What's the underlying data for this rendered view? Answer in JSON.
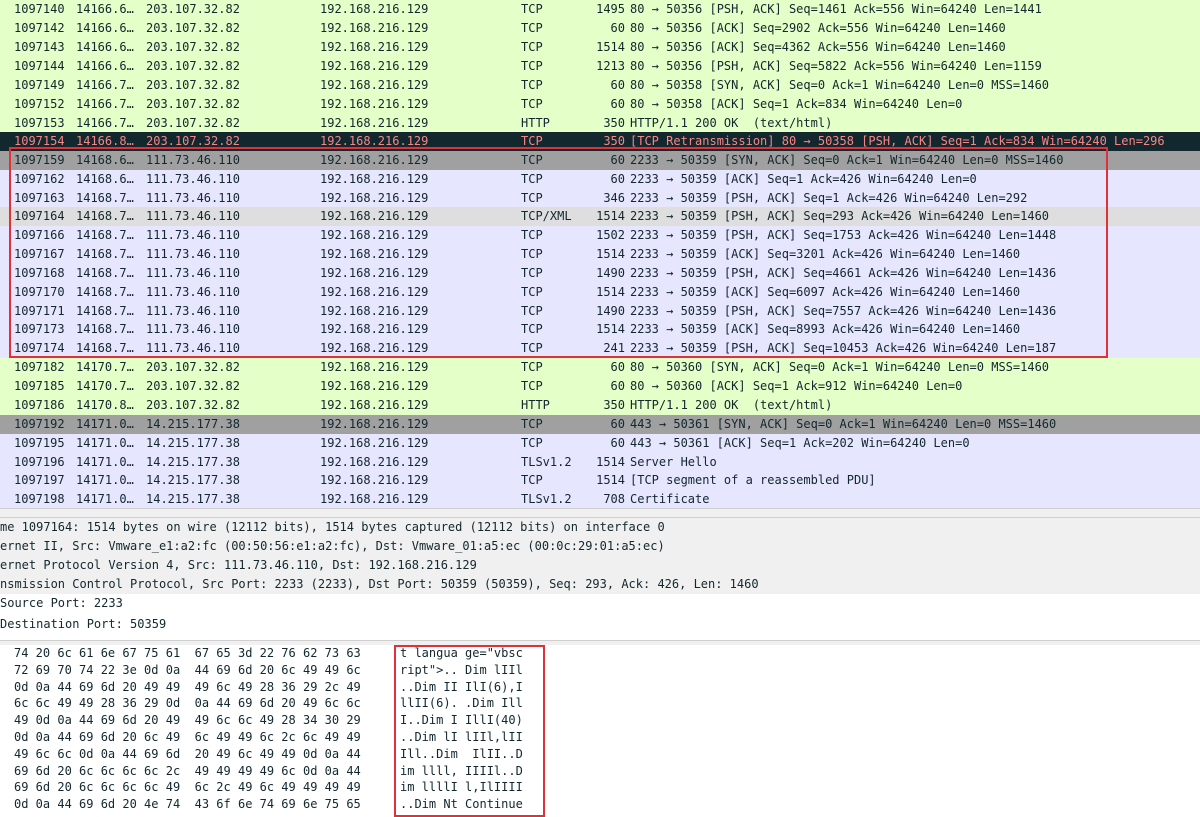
{
  "packets": [
    {
      "no": "1097140",
      "time": "14166.6…",
      "src": "203.107.32.82",
      "dst": "192.168.216.129",
      "proto": "TCP",
      "len": "1495",
      "info": "80 → 50356 [PSH, ACK] Seq=1461 Ack=556 Win=64240 Len=1441",
      "style": "green"
    },
    {
      "no": "1097142",
      "time": "14166.6…",
      "src": "203.107.32.82",
      "dst": "192.168.216.129",
      "proto": "TCP",
      "len": "60",
      "info": "80 → 50356 [ACK] Seq=2902 Ack=556 Win=64240 Len=1460",
      "style": "green"
    },
    {
      "no": "1097143",
      "time": "14166.6…",
      "src": "203.107.32.82",
      "dst": "192.168.216.129",
      "proto": "TCP",
      "len": "1514",
      "info": "80 → 50356 [ACK] Seq=4362 Ack=556 Win=64240 Len=1460",
      "style": "green"
    },
    {
      "no": "1097144",
      "time": "14166.6…",
      "src": "203.107.32.82",
      "dst": "192.168.216.129",
      "proto": "TCP",
      "len": "1213",
      "info": "80 → 50356 [PSH, ACK] Seq=5822 Ack=556 Win=64240 Len=1159",
      "style": "green"
    },
    {
      "no": "1097149",
      "time": "14166.7…",
      "src": "203.107.32.82",
      "dst": "192.168.216.129",
      "proto": "TCP",
      "len": "60",
      "info": "80 → 50358 [SYN, ACK] Seq=0 Ack=1 Win=64240 Len=0 MSS=1460",
      "style": "green"
    },
    {
      "no": "1097152",
      "time": "14166.7…",
      "src": "203.107.32.82",
      "dst": "192.168.216.129",
      "proto": "TCP",
      "len": "60",
      "info": "80 → 50358 [ACK] Seq=1 Ack=834 Win=64240 Len=0",
      "style": "green"
    },
    {
      "no": "1097153",
      "time": "14166.7…",
      "src": "203.107.32.82",
      "dst": "192.168.216.129",
      "proto": "HTTP",
      "len": "350",
      "info": "HTTP/1.1 200 OK  (text/html)",
      "style": "green"
    },
    {
      "no": "1097154",
      "time": "14166.8…",
      "src": "203.107.32.82",
      "dst": "192.168.216.129",
      "proto": "TCP",
      "len": "350",
      "info": "[TCP Retransmission] 80 → 50358 [PSH, ACK] Seq=1 Ack=834 Win=64240 Len=296",
      "style": "dark"
    },
    {
      "no": "1097159",
      "time": "14168.6…",
      "src": "111.73.46.110",
      "dst": "192.168.216.129",
      "proto": "TCP",
      "len": "60",
      "info": "2233 → 50359 [SYN, ACK] Seq=0 Ack=1 Win=64240 Len=0 MSS=1460",
      "style": "gray"
    },
    {
      "no": "1097162",
      "time": "14168.6…",
      "src": "111.73.46.110",
      "dst": "192.168.216.129",
      "proto": "TCP",
      "len": "60",
      "info": "2233 → 50359 [ACK] Seq=1 Ack=426 Win=64240 Len=0",
      "style": "blue"
    },
    {
      "no": "1097163",
      "time": "14168.7…",
      "src": "111.73.46.110",
      "dst": "192.168.216.129",
      "proto": "TCP",
      "len": "346",
      "info": "2233 → 50359 [PSH, ACK] Seq=1 Ack=426 Win=64240 Len=292",
      "style": "blue"
    },
    {
      "no": "1097164",
      "time": "14168.7…",
      "src": "111.73.46.110",
      "dst": "192.168.216.129",
      "proto": "TCP/XML",
      "len": "1514",
      "info": "2233 → 50359 [PSH, ACK] Seq=293 Ack=426 Win=64240 Len=1460",
      "style": "xml"
    },
    {
      "no": "1097166",
      "time": "14168.7…",
      "src": "111.73.46.110",
      "dst": "192.168.216.129",
      "proto": "TCP",
      "len": "1502",
      "info": "2233 → 50359 [PSH, ACK] Seq=1753 Ack=426 Win=64240 Len=1448",
      "style": "blue"
    },
    {
      "no": "1097167",
      "time": "14168.7…",
      "src": "111.73.46.110",
      "dst": "192.168.216.129",
      "proto": "TCP",
      "len": "1514",
      "info": "2233 → 50359 [ACK] Seq=3201 Ack=426 Win=64240 Len=1460",
      "style": "blue"
    },
    {
      "no": "1097168",
      "time": "14168.7…",
      "src": "111.73.46.110",
      "dst": "192.168.216.129",
      "proto": "TCP",
      "len": "1490",
      "info": "2233 → 50359 [PSH, ACK] Seq=4661 Ack=426 Win=64240 Len=1436",
      "style": "blue"
    },
    {
      "no": "1097170",
      "time": "14168.7…",
      "src": "111.73.46.110",
      "dst": "192.168.216.129",
      "proto": "TCP",
      "len": "1514",
      "info": "2233 → 50359 [ACK] Seq=6097 Ack=426 Win=64240 Len=1460",
      "style": "blue"
    },
    {
      "no": "1097171",
      "time": "14168.7…",
      "src": "111.73.46.110",
      "dst": "192.168.216.129",
      "proto": "TCP",
      "len": "1490",
      "info": "2233 → 50359 [PSH, ACK] Seq=7557 Ack=426 Win=64240 Len=1436",
      "style": "blue"
    },
    {
      "no": "1097173",
      "time": "14168.7…",
      "src": "111.73.46.110",
      "dst": "192.168.216.129",
      "proto": "TCP",
      "len": "1514",
      "info": "2233 → 50359 [ACK] Seq=8993 Ack=426 Win=64240 Len=1460",
      "style": "blue"
    },
    {
      "no": "1097174",
      "time": "14168.7…",
      "src": "111.73.46.110",
      "dst": "192.168.216.129",
      "proto": "TCP",
      "len": "241",
      "info": "2233 → 50359 [PSH, ACK] Seq=10453 Ack=426 Win=64240 Len=187",
      "style": "blue"
    },
    {
      "no": "1097182",
      "time": "14170.7…",
      "src": "203.107.32.82",
      "dst": "192.168.216.129",
      "proto": "TCP",
      "len": "60",
      "info": "80 → 50360 [SYN, ACK] Seq=0 Ack=1 Win=64240 Len=0 MSS=1460",
      "style": "green"
    },
    {
      "no": "1097185",
      "time": "14170.7…",
      "src": "203.107.32.82",
      "dst": "192.168.216.129",
      "proto": "TCP",
      "len": "60",
      "info": "80 → 50360 [ACK] Seq=1 Ack=912 Win=64240 Len=0",
      "style": "green"
    },
    {
      "no": "1097186",
      "time": "14170.8…",
      "src": "203.107.32.82",
      "dst": "192.168.216.129",
      "proto": "HTTP",
      "len": "350",
      "info": "HTTP/1.1 200 OK  (text/html)",
      "style": "green"
    },
    {
      "no": "1097192",
      "time": "14171.0…",
      "src": "14.215.177.38",
      "dst": "192.168.216.129",
      "proto": "TCP",
      "len": "60",
      "info": "443 → 50361 [SYN, ACK] Seq=0 Ack=1 Win=64240 Len=0 MSS=1460",
      "style": "gray"
    },
    {
      "no": "1097195",
      "time": "14171.0…",
      "src": "14.215.177.38",
      "dst": "192.168.216.129",
      "proto": "TCP",
      "len": "60",
      "info": "443 → 50361 [ACK] Seq=1 Ack=202 Win=64240 Len=0",
      "style": "blue"
    },
    {
      "no": "1097196",
      "time": "14171.0…",
      "src": "14.215.177.38",
      "dst": "192.168.216.129",
      "proto": "TLSv1.2",
      "len": "1514",
      "info": "Server Hello",
      "style": "blue"
    },
    {
      "no": "1097197",
      "time": "14171.0…",
      "src": "14.215.177.38",
      "dst": "192.168.216.129",
      "proto": "TCP",
      "len": "1514",
      "info": "[TCP segment of a reassembled PDU]",
      "style": "blue"
    },
    {
      "no": "1097198",
      "time": "14171.0…",
      "src": "14.215.177.38",
      "dst": "192.168.216.129",
      "proto": "TLSv1.2",
      "len": "708",
      "info": "Certificate",
      "style": "blue"
    }
  ],
  "details": [
    "me 1097164: 1514 bytes on wire (12112 bits), 1514 bytes captured (12112 bits) on interface 0",
    "ernet II, Src: Vmware_e1:a2:fc (00:50:56:e1:a2:fc), Dst: Vmware_01:a5:ec (00:0c:29:01:a5:ec)",
    "ernet Protocol Version 4, Src: 111.73.46.110, Dst: 192.168.216.129",
    "nsmission Control Protocol, Src Port: 2233 (2233), Dst Port: 50359 (50359), Seq: 293, Ack: 426, Len: 1460",
    "Source Port: 2233",
    "Destination Port: 50359"
  ],
  "hex_rows": [
    {
      "hex": "74 20 6c 61 6e 67 75 61  67 65 3d 22 76 62 73 63",
      "ascii": "t langua ge=\"vbsc"
    },
    {
      "hex": "72 69 70 74 22 3e 0d 0a  44 69 6d 20 6c 49 49 6c",
      "ascii": "ript\">.. Dim lIIl"
    },
    {
      "hex": "0d 0a 44 69 6d 20 49 49  49 6c 49 28 36 29 2c 49",
      "ascii": "..Dim II IlI(6),I"
    },
    {
      "hex": "6c 6c 49 49 28 36 29 0d  0a 44 69 6d 20 49 6c 6c",
      "ascii": "llII(6). .Dim Ill"
    },
    {
      "hex": "49 0d 0a 44 69 6d 20 49  49 6c 6c 49 28 34 30 29",
      "ascii": "I..Dim I IllI(40)"
    },
    {
      "hex": "0d 0a 44 69 6d 20 6c 49  6c 49 49 6c 2c 6c 49 49",
      "ascii": "..Dim lI lIIl,lII"
    },
    {
      "hex": "49 6c 6c 0d 0a 44 69 6d  20 49 6c 49 49 0d 0a 44",
      "ascii": "Ill..Dim  IlII..D"
    },
    {
      "hex": "69 6d 20 6c 6c 6c 6c 2c  49 49 49 49 6c 0d 0a 44",
      "ascii": "im llll, IIIIl..D"
    },
    {
      "hex": "69 6d 20 6c 6c 6c 6c 49  6c 2c 49 6c 49 49 49 49",
      "ascii": "im llllI l,IlIIII"
    },
    {
      "hex": "0d 0a 44 69 6d 20 4e 74  43 6f 6e 74 69 6e 75 65",
      "ascii": "..Dim Nt Continue"
    }
  ]
}
